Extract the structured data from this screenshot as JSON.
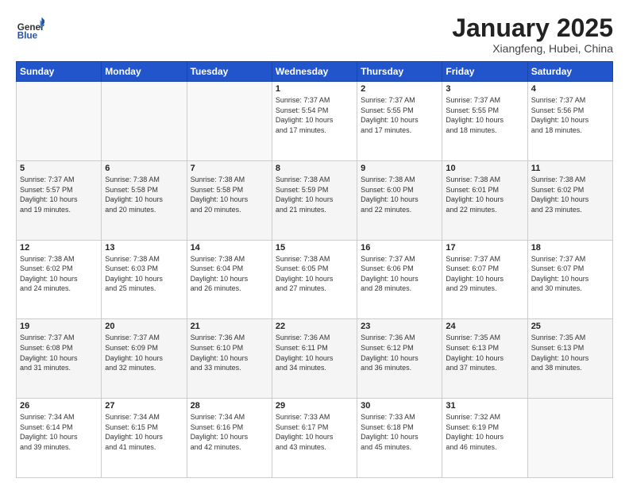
{
  "logo": {
    "general": "General",
    "blue": "Blue"
  },
  "header": {
    "title": "January 2025",
    "subtitle": "Xiangfeng, Hubei, China"
  },
  "weekdays": [
    "Sunday",
    "Monday",
    "Tuesday",
    "Wednesday",
    "Thursday",
    "Friday",
    "Saturday"
  ],
  "weeks": [
    [
      {
        "day": "",
        "info": ""
      },
      {
        "day": "",
        "info": ""
      },
      {
        "day": "",
        "info": ""
      },
      {
        "day": "1",
        "info": "Sunrise: 7:37 AM\nSunset: 5:54 PM\nDaylight: 10 hours\nand 17 minutes."
      },
      {
        "day": "2",
        "info": "Sunrise: 7:37 AM\nSunset: 5:55 PM\nDaylight: 10 hours\nand 17 minutes."
      },
      {
        "day": "3",
        "info": "Sunrise: 7:37 AM\nSunset: 5:55 PM\nDaylight: 10 hours\nand 18 minutes."
      },
      {
        "day": "4",
        "info": "Sunrise: 7:37 AM\nSunset: 5:56 PM\nDaylight: 10 hours\nand 18 minutes."
      }
    ],
    [
      {
        "day": "5",
        "info": "Sunrise: 7:37 AM\nSunset: 5:57 PM\nDaylight: 10 hours\nand 19 minutes."
      },
      {
        "day": "6",
        "info": "Sunrise: 7:38 AM\nSunset: 5:58 PM\nDaylight: 10 hours\nand 20 minutes."
      },
      {
        "day": "7",
        "info": "Sunrise: 7:38 AM\nSunset: 5:58 PM\nDaylight: 10 hours\nand 20 minutes."
      },
      {
        "day": "8",
        "info": "Sunrise: 7:38 AM\nSunset: 5:59 PM\nDaylight: 10 hours\nand 21 minutes."
      },
      {
        "day": "9",
        "info": "Sunrise: 7:38 AM\nSunset: 6:00 PM\nDaylight: 10 hours\nand 22 minutes."
      },
      {
        "day": "10",
        "info": "Sunrise: 7:38 AM\nSunset: 6:01 PM\nDaylight: 10 hours\nand 22 minutes."
      },
      {
        "day": "11",
        "info": "Sunrise: 7:38 AM\nSunset: 6:02 PM\nDaylight: 10 hours\nand 23 minutes."
      }
    ],
    [
      {
        "day": "12",
        "info": "Sunrise: 7:38 AM\nSunset: 6:02 PM\nDaylight: 10 hours\nand 24 minutes."
      },
      {
        "day": "13",
        "info": "Sunrise: 7:38 AM\nSunset: 6:03 PM\nDaylight: 10 hours\nand 25 minutes."
      },
      {
        "day": "14",
        "info": "Sunrise: 7:38 AM\nSunset: 6:04 PM\nDaylight: 10 hours\nand 26 minutes."
      },
      {
        "day": "15",
        "info": "Sunrise: 7:38 AM\nSunset: 6:05 PM\nDaylight: 10 hours\nand 27 minutes."
      },
      {
        "day": "16",
        "info": "Sunrise: 7:37 AM\nSunset: 6:06 PM\nDaylight: 10 hours\nand 28 minutes."
      },
      {
        "day": "17",
        "info": "Sunrise: 7:37 AM\nSunset: 6:07 PM\nDaylight: 10 hours\nand 29 minutes."
      },
      {
        "day": "18",
        "info": "Sunrise: 7:37 AM\nSunset: 6:07 PM\nDaylight: 10 hours\nand 30 minutes."
      }
    ],
    [
      {
        "day": "19",
        "info": "Sunrise: 7:37 AM\nSunset: 6:08 PM\nDaylight: 10 hours\nand 31 minutes."
      },
      {
        "day": "20",
        "info": "Sunrise: 7:37 AM\nSunset: 6:09 PM\nDaylight: 10 hours\nand 32 minutes."
      },
      {
        "day": "21",
        "info": "Sunrise: 7:36 AM\nSunset: 6:10 PM\nDaylight: 10 hours\nand 33 minutes."
      },
      {
        "day": "22",
        "info": "Sunrise: 7:36 AM\nSunset: 6:11 PM\nDaylight: 10 hours\nand 34 minutes."
      },
      {
        "day": "23",
        "info": "Sunrise: 7:36 AM\nSunset: 6:12 PM\nDaylight: 10 hours\nand 36 minutes."
      },
      {
        "day": "24",
        "info": "Sunrise: 7:35 AM\nSunset: 6:13 PM\nDaylight: 10 hours\nand 37 minutes."
      },
      {
        "day": "25",
        "info": "Sunrise: 7:35 AM\nSunset: 6:13 PM\nDaylight: 10 hours\nand 38 minutes."
      }
    ],
    [
      {
        "day": "26",
        "info": "Sunrise: 7:34 AM\nSunset: 6:14 PM\nDaylight: 10 hours\nand 39 minutes."
      },
      {
        "day": "27",
        "info": "Sunrise: 7:34 AM\nSunset: 6:15 PM\nDaylight: 10 hours\nand 41 minutes."
      },
      {
        "day": "28",
        "info": "Sunrise: 7:34 AM\nSunset: 6:16 PM\nDaylight: 10 hours\nand 42 minutes."
      },
      {
        "day": "29",
        "info": "Sunrise: 7:33 AM\nSunset: 6:17 PM\nDaylight: 10 hours\nand 43 minutes."
      },
      {
        "day": "30",
        "info": "Sunrise: 7:33 AM\nSunset: 6:18 PM\nDaylight: 10 hours\nand 45 minutes."
      },
      {
        "day": "31",
        "info": "Sunrise: 7:32 AM\nSunset: 6:19 PM\nDaylight: 10 hours\nand 46 minutes."
      },
      {
        "day": "",
        "info": ""
      }
    ]
  ]
}
